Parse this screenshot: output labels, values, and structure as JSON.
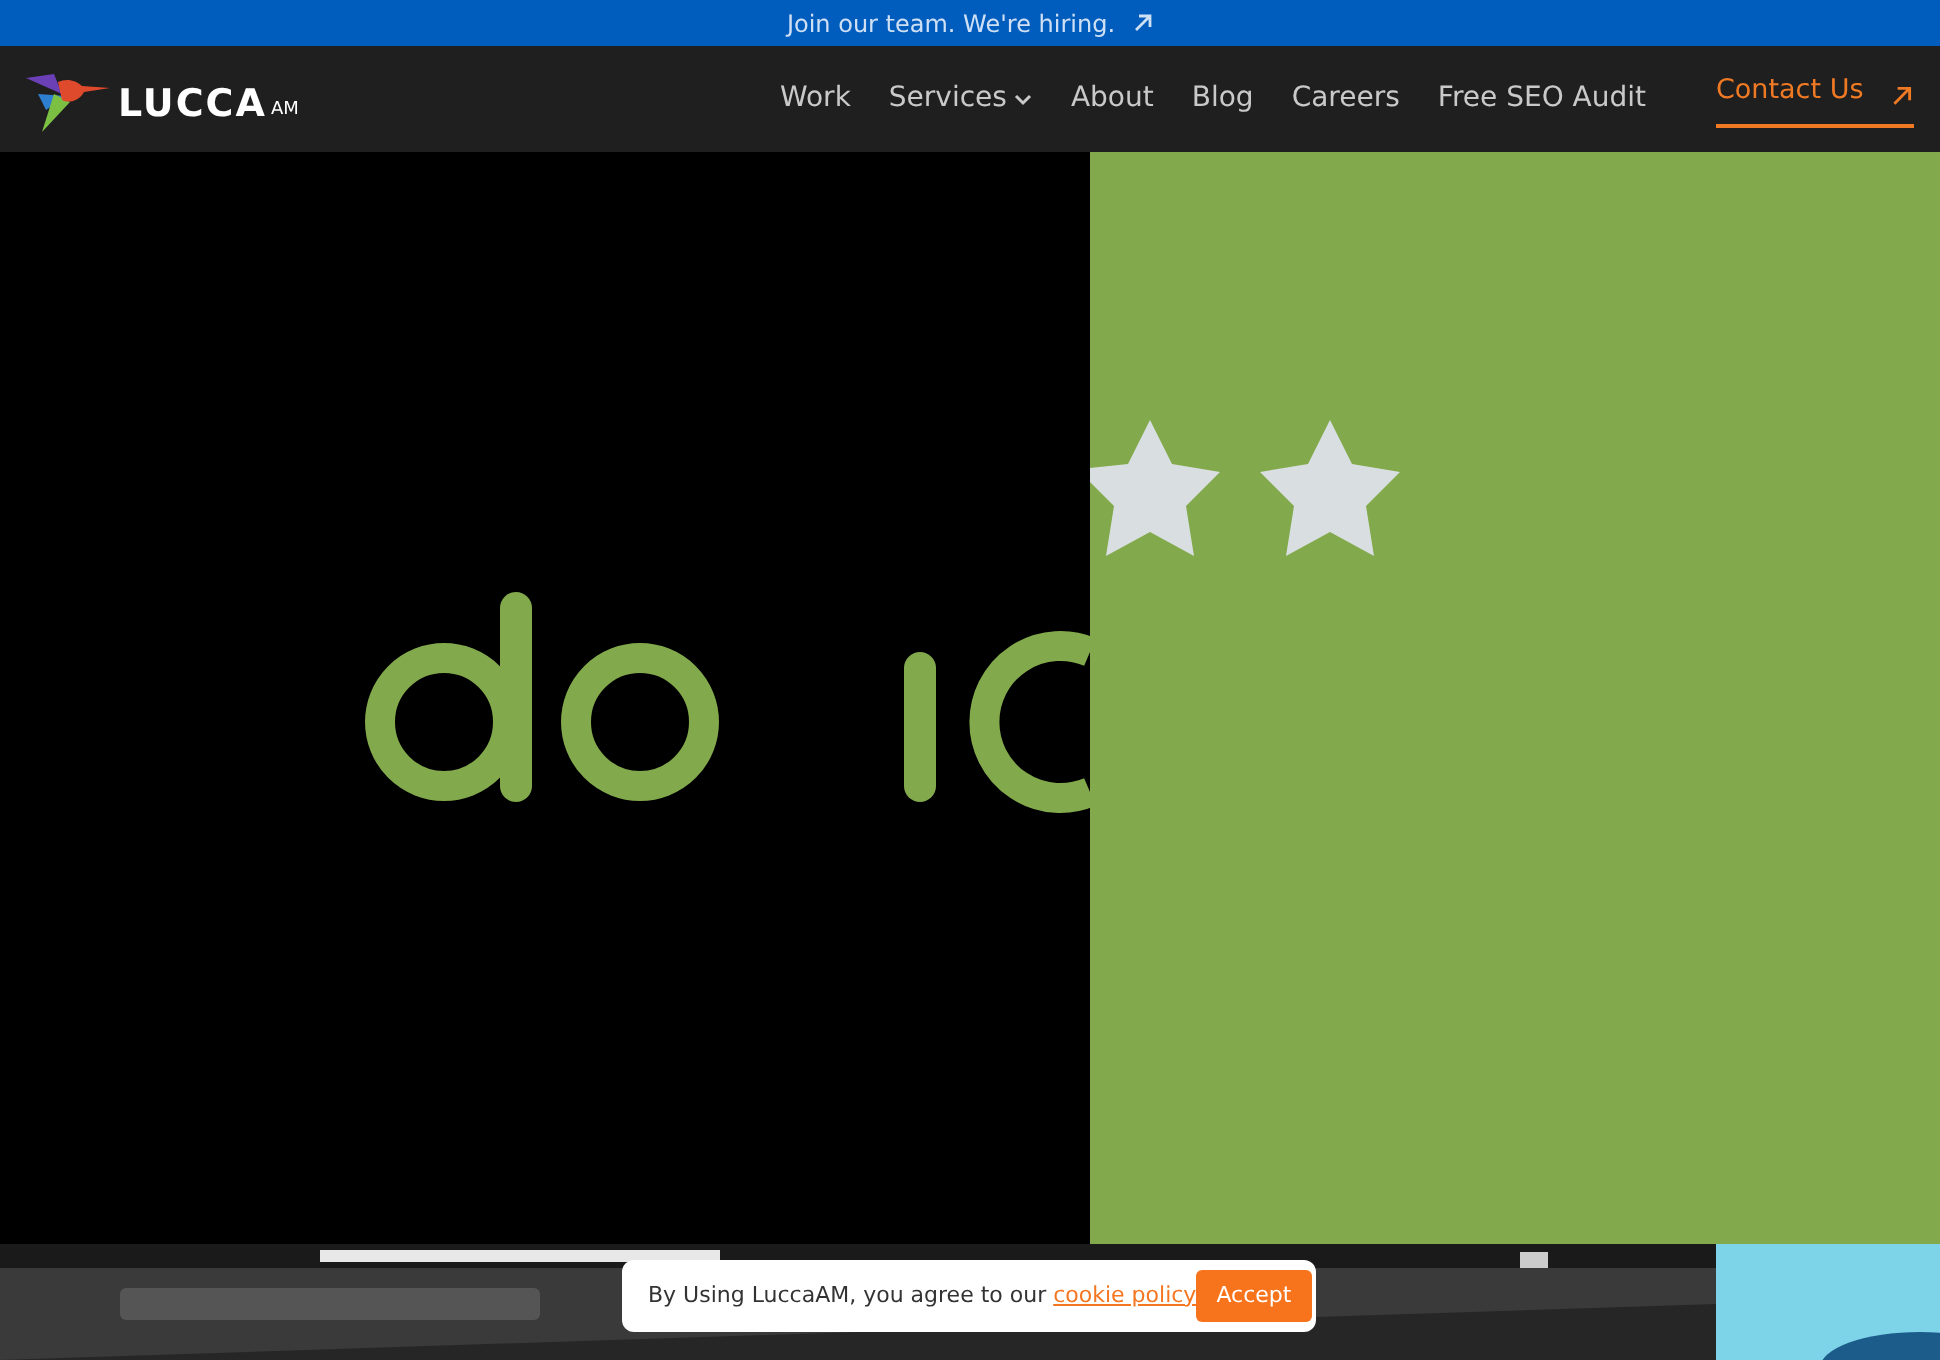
{
  "announcement": {
    "text": "Join our team. We're hiring."
  },
  "logo": {
    "wordmark": "LUCCA",
    "suffix": "AM"
  },
  "nav": [
    {
      "label": "Work",
      "kind": "link"
    },
    {
      "label": "Services",
      "kind": "dropdown"
    },
    {
      "label": "About",
      "kind": "link"
    },
    {
      "label": "Blog",
      "kind": "link"
    },
    {
      "label": "Careers",
      "kind": "link"
    },
    {
      "label": "Free SEO Audit",
      "kind": "link"
    }
  ],
  "contact_button": {
    "label": "Contact Us"
  },
  "cookie_banner": {
    "text": "By Using LuccaAM, you agree to our",
    "link": "cookie policy",
    "button": "Accept"
  }
}
